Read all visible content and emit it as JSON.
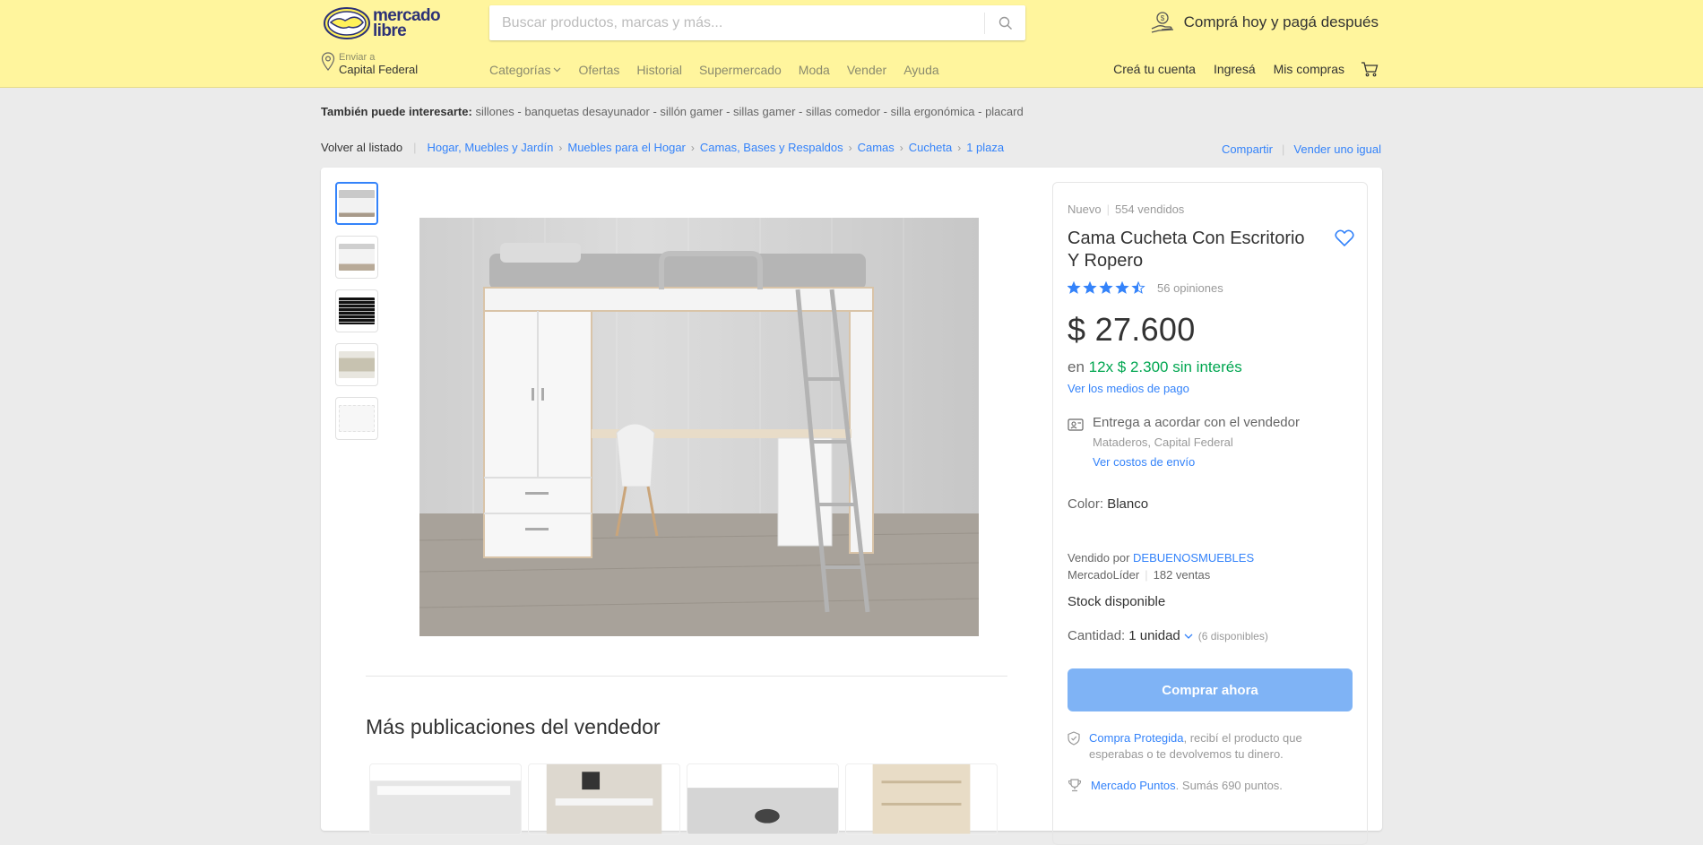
{
  "header": {
    "logo_line1": "mercado",
    "logo_line2": "libre",
    "search_placeholder": "Buscar productos, marcas y más...",
    "promo": "Comprá hoy y pagá después",
    "location_label": "Enviar a",
    "location_value": "Capital Federal",
    "nav": [
      "Categorías",
      "Ofertas",
      "Historial",
      "Supermercado",
      "Moda",
      "Vender",
      "Ayuda"
    ],
    "user_nav": [
      "Creá tu cuenta",
      "Ingresá",
      "Mis compras"
    ]
  },
  "interests": {
    "label": "También puede interesarte:",
    "items": "sillones - banquetas desayunador - sillón gamer - sillas gamer - sillas comedor - silla ergonómica - placard"
  },
  "breadcrumb": {
    "back": "Volver al listado",
    "items": [
      "Hogar, Muebles y Jardín",
      "Muebles para el Hogar",
      "Camas, Bases y Respaldos",
      "Camas",
      "Cucheta",
      "1 plaza"
    ],
    "share": "Compartir",
    "sell_same": "Vender uno igual"
  },
  "product": {
    "condition": "Nuevo",
    "sold": "554 vendidos",
    "title": "Cama Cucheta Con Escritorio Y Ropero",
    "rating": 4.5,
    "reviews": "56 opiniones",
    "price": "$ 27.600",
    "installments_prefix": "en",
    "installments": "12x $ 2.300 sin interés",
    "payment_link": "Ver los medios de pago",
    "shipping": {
      "title": "Entrega a acordar con el vendedor",
      "location": "Mataderos, Capital Federal",
      "link": "Ver costos de envío"
    },
    "color_label": "Color:",
    "color_value": "Blanco",
    "seller_prefix": "Vendido por",
    "seller_name": "DEBUENOSMUEBLES",
    "seller_badge": "MercadoLíder",
    "seller_sales": "182 ventas",
    "stock": "Stock disponible",
    "qty_label": "Cantidad:",
    "qty_value": "1 unidad",
    "qty_available": "(6 disponibles)",
    "buy_button": "Comprar ahora",
    "protected_link": "Compra Protegida",
    "protected_text": ", recibí el producto que esperabas o te devolvemos tu dinero.",
    "points_link": "Mercado Puntos",
    "points_text": ". Sumás 690 puntos."
  },
  "more": {
    "title": "Más publicaciones del vendedor"
  },
  "colors": {
    "header_bg": "#fff59d",
    "accent_blue": "#3483fa",
    "green": "#00a650",
    "buy_button": "#7fb3f5"
  }
}
